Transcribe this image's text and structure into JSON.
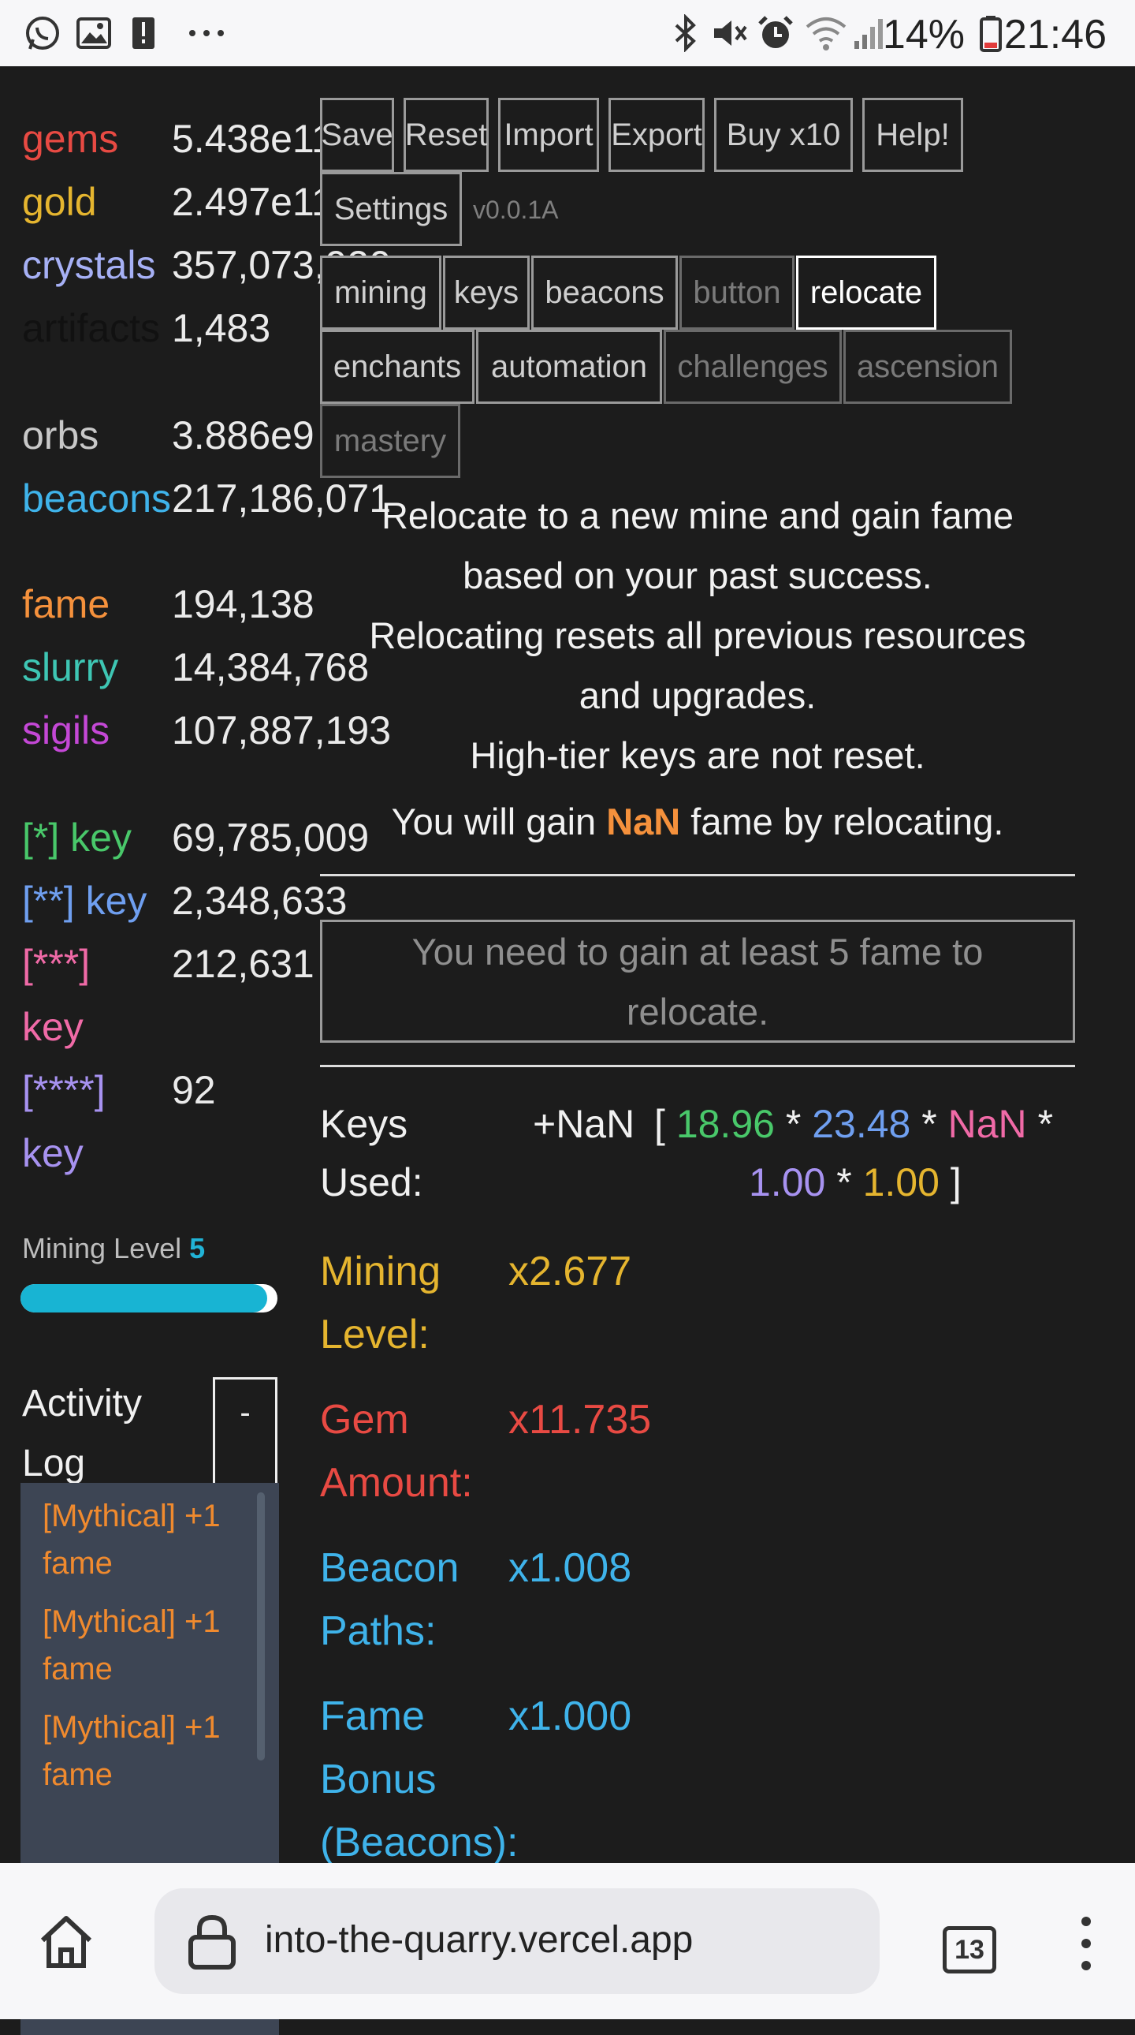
{
  "status_bar": {
    "battery_pct": "14%",
    "time": "21:46",
    "icons": [
      "whatsapp-icon",
      "image-icon",
      "alert-icon",
      "more-icon",
      "bluetooth-icon",
      "mute-icon",
      "alarm-icon",
      "wifi-icon",
      "signal-icon",
      "battery-icon"
    ]
  },
  "resources": [
    {
      "name": "gems",
      "value": "5.438e11",
      "color": "#e84a43"
    },
    {
      "name": "gold",
      "value": "2.497e11",
      "color": "#e5b52f"
    },
    {
      "name": "crystals",
      "value": "357,073,920",
      "color": "#a6b0f5"
    },
    {
      "name": "artifacts",
      "value": "1,483",
      "color": "#111111"
    },
    {
      "name": "orbs",
      "value": "3.886e9",
      "color": "#c8c8c8"
    },
    {
      "name": "beacons",
      "value": "217,186,071",
      "color": "#3fb3ea"
    },
    {
      "name": "fame",
      "value": "194,138",
      "color": "#f5913c"
    },
    {
      "name": "slurry",
      "value": "14,384,768",
      "color": "#3ec6b4"
    },
    {
      "name": "sigils",
      "value": "107,887,193",
      "color": "#c448d6"
    }
  ],
  "keys": [
    {
      "name": "[*] key",
      "value": "69,785,009",
      "color": "#49c86a"
    },
    {
      "name": "[**] key",
      "value": "2,348,633",
      "color": "#6f9ff0"
    },
    {
      "name_line1": "[***]",
      "name_line2": "key",
      "value": "212,631",
      "color": "#f06aa7"
    },
    {
      "name_line1": "[****]",
      "name_line2": "key",
      "value": "92",
      "color": "#a792f0"
    }
  ],
  "mining_level": {
    "label": "Mining Level ",
    "level": "5",
    "progress": 0.96
  },
  "activity_log": {
    "title_line1": "Activity",
    "title_line2": "Log",
    "collapse_label": "-",
    "entries": [
      {
        "line1": "[Mythical] +1",
        "line2": "fame"
      },
      {
        "line1": "[Mythical] +1",
        "line2": "fame"
      },
      {
        "line1": "[Mythical] +1",
        "line2": "fame"
      }
    ]
  },
  "toolbar": {
    "save": "Save",
    "reset": "Reset",
    "import": "Import",
    "export": "Export",
    "buy": "Buy x10",
    "help": "Help!",
    "settings": "Settings",
    "version": "v0.0.1A"
  },
  "tabs": {
    "mining": "mining",
    "keys": "keys",
    "beacons": "beacons",
    "button": "button",
    "relocate": "relocate",
    "enchants": "enchants",
    "automation": "automation",
    "challenges": "challenges",
    "ascension": "ascension",
    "mastery": "mastery"
  },
  "relocate": {
    "desc_1": "Relocate to a new mine and gain fame",
    "desc_2": "based on your past success.",
    "desc_3": "Relocating resets all previous resources",
    "desc_4": "and upgrades.",
    "desc_5": "High-tier keys are not reset.",
    "gain_pre": "You will gain ",
    "gain_value": "NaN",
    "gain_post": " fame by relocating.",
    "button_line1": "You need to gain at least 5 fame to",
    "button_line2": "relocate."
  },
  "keys_used": {
    "label_line1": "Keys",
    "label_line2": "Used:",
    "value": "+NaN",
    "open_bracket": "[",
    "k1": "18.96",
    "k2": "23.48",
    "k3": "NaN",
    "k4": "1.00",
    "k5": "1.00",
    "times": "*",
    "close_bracket": "]"
  },
  "multipliers": [
    {
      "label_line1": "Mining",
      "label_line2": "Level:",
      "value": "x2.677",
      "color": "#e5b52f"
    },
    {
      "label_line1": "Gem",
      "label_line2": "Amount:",
      "value": "x11.735",
      "color": "#e84a43"
    },
    {
      "label_line1": "Beacon",
      "label_line2": "Paths:",
      "value": "x1.008",
      "color": "#3fb3ea"
    },
    {
      "label_line1": "Fame",
      "label_line2": "Bonus",
      "label_line3": "(Beacons):",
      "value": "x1.000",
      "color": "#3fb3ea"
    }
  ],
  "browser": {
    "url": "into-the-quarry.vercel.app",
    "tab_count": "13"
  }
}
